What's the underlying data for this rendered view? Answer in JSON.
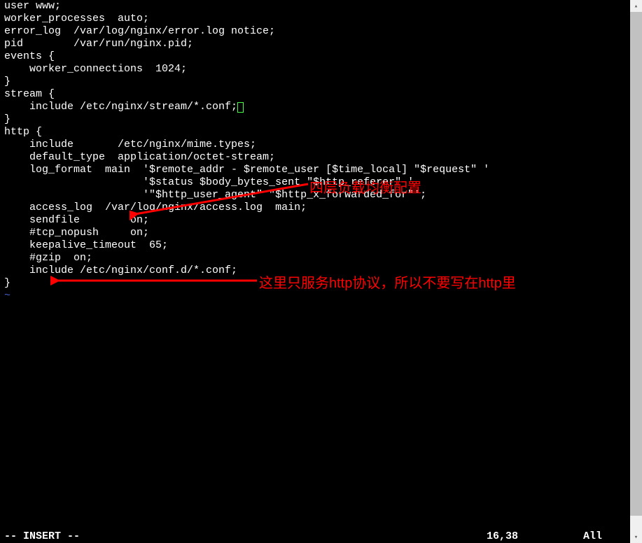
{
  "editor": {
    "lines": [
      "user www;",
      "worker_processes  auto;",
      "",
      "error_log  /var/log/nginx/error.log notice;",
      "pid        /var/run/nginx.pid;",
      "",
      "",
      "events {",
      "    worker_connections  1024;",
      "}",
      "",
      "",
      "stream {",
      "",
      "    include /etc/nginx/stream/*.conf;",
      "",
      "}",
      "",
      "http {",
      "    include       /etc/nginx/mime.types;",
      "    default_type  application/octet-stream;",
      "",
      "    log_format  main  '$remote_addr - $remote_user [$time_local] \"$request\" '",
      "                      '$status $body_bytes_sent \"$http_referer\" '",
      "                      '\"$http_user_agent\" \"$http_x_forwarded_for\"';",
      "",
      "    access_log  /var/log/nginx/access.log  main;",
      "",
      "    sendfile        on;",
      "    #tcp_nopush     on;",
      "",
      "    keepalive_timeout  65;",
      "",
      "    #gzip  on;",
      "",
      "    include /etc/nginx/conf.d/*.conf;",
      "",
      "}"
    ],
    "cursor_line_index": 14,
    "end_tilde": "~"
  },
  "status": {
    "mode": "-- INSERT --",
    "position": "16,38",
    "scroll": "All"
  },
  "annotations": {
    "ann1": "四层负载均衡配置",
    "ann2": "这里只服务http协议，所以不要写在http里"
  },
  "scrollbar": {
    "up_glyph": "▴",
    "down_glyph": "▾"
  }
}
